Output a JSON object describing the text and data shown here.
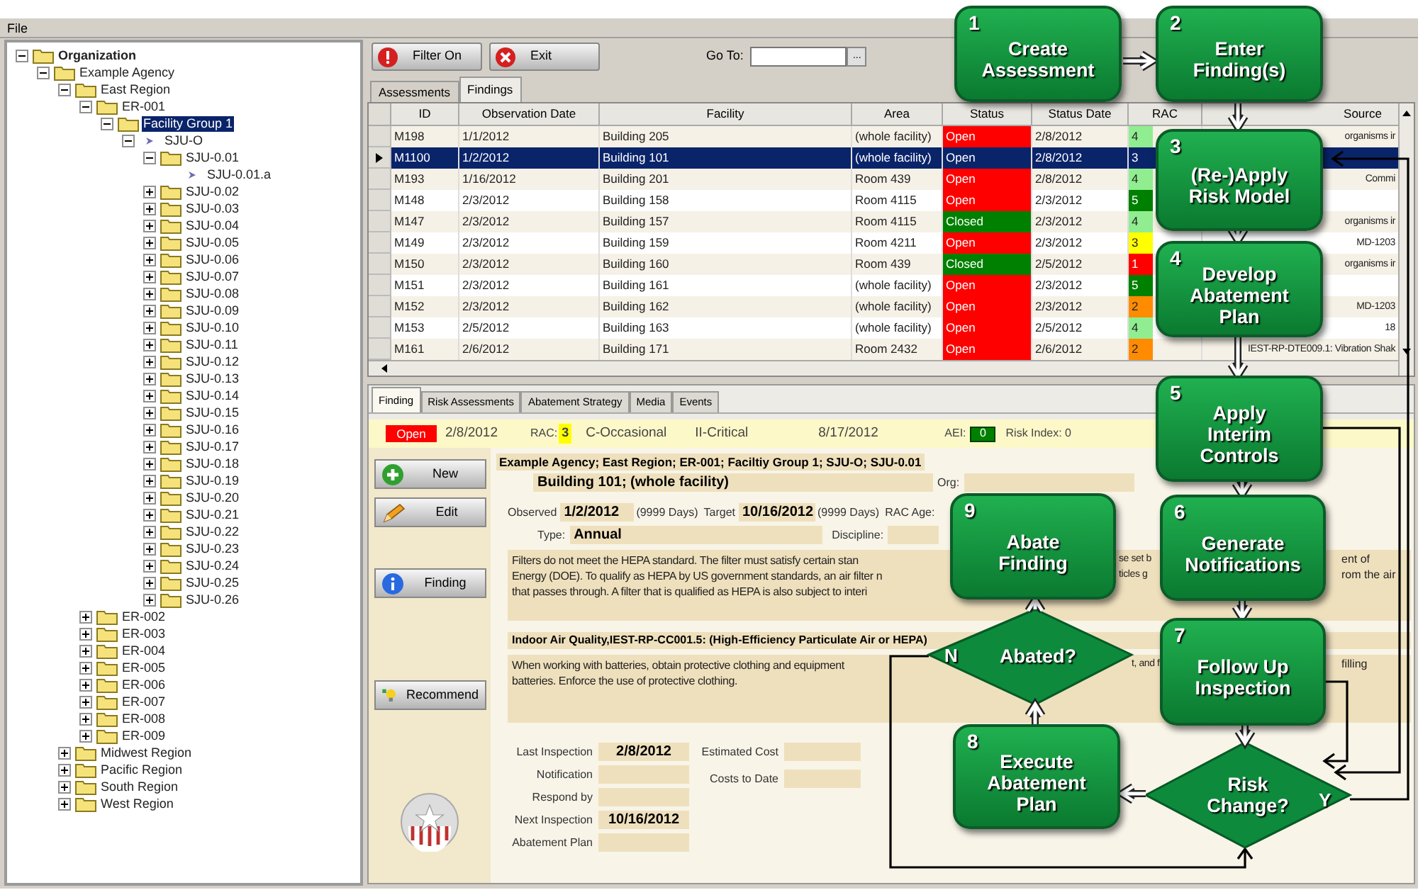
{
  "menu": [
    "File"
  ],
  "tree": {
    "label": "Organization",
    "kind": "folder",
    "expanded": true,
    "selected": false,
    "children": [
      {
        "label": "Example Agency",
        "kind": "folder",
        "expanded": true,
        "selected": false,
        "children": [
          {
            "label": "East Region",
            "kind": "folder",
            "expanded": true,
            "selected": false,
            "children": [
              {
                "label": "ER-001",
                "kind": "folder",
                "expanded": true,
                "selected": false,
                "children": [
                  {
                    "label": "Facility Group 1",
                    "kind": "folder",
                    "expanded": true,
                    "selected": true,
                    "children": [
                      {
                        "label": "SJU-O",
                        "kind": "item",
                        "expanded": true,
                        "selected": false,
                        "children": [
                          {
                            "label": "SJU-0.01",
                            "kind": "folder",
                            "expanded": true,
                            "selected": false,
                            "children": [
                              {
                                "label": "SJU-0.01.a",
                                "kind": "item",
                                "selected": false
                              }
                            ]
                          },
                          {
                            "label": "SJU-0.02",
                            "kind": "folder",
                            "expanded": false,
                            "selected": false
                          },
                          {
                            "label": "SJU-0.03",
                            "kind": "folder",
                            "expanded": false,
                            "selected": false
                          },
                          {
                            "label": "SJU-0.04",
                            "kind": "folder",
                            "expanded": false,
                            "selected": false
                          },
                          {
                            "label": "SJU-0.05",
                            "kind": "folder",
                            "expanded": false,
                            "selected": false
                          },
                          {
                            "label": "SJU-0.06",
                            "kind": "folder",
                            "expanded": false,
                            "selected": false
                          },
                          {
                            "label": "SJU-0.07",
                            "kind": "folder",
                            "expanded": false,
                            "selected": false
                          },
                          {
                            "label": "SJU-0.08",
                            "kind": "folder",
                            "expanded": false,
                            "selected": false
                          },
                          {
                            "label": "SJU-0.09",
                            "kind": "folder",
                            "expanded": false,
                            "selected": false
                          },
                          {
                            "label": "SJU-0.10",
                            "kind": "folder",
                            "expanded": false,
                            "selected": false
                          },
                          {
                            "label": "SJU-0.11",
                            "kind": "folder",
                            "expanded": false,
                            "selected": false
                          },
                          {
                            "label": "SJU-0.12",
                            "kind": "folder",
                            "expanded": false,
                            "selected": false
                          },
                          {
                            "label": "SJU-0.13",
                            "kind": "folder",
                            "expanded": false,
                            "selected": false
                          },
                          {
                            "label": "SJU-0.14",
                            "kind": "folder",
                            "expanded": false,
                            "selected": false
                          },
                          {
                            "label": "SJU-0.15",
                            "kind": "folder",
                            "expanded": false,
                            "selected": false
                          },
                          {
                            "label": "SJU-0.16",
                            "kind": "folder",
                            "expanded": false,
                            "selected": false
                          },
                          {
                            "label": "SJU-0.17",
                            "kind": "folder",
                            "expanded": false,
                            "selected": false
                          },
                          {
                            "label": "SJU-0.18",
                            "kind": "folder",
                            "expanded": false,
                            "selected": false
                          },
                          {
                            "label": "SJU-0.19",
                            "kind": "folder",
                            "expanded": false,
                            "selected": false
                          },
                          {
                            "label": "SJU-0.20",
                            "kind": "folder",
                            "expanded": false,
                            "selected": false
                          },
                          {
                            "label": "SJU-0.21",
                            "kind": "folder",
                            "expanded": false,
                            "selected": false
                          },
                          {
                            "label": "SJU-0.22",
                            "kind": "folder",
                            "expanded": false,
                            "selected": false
                          },
                          {
                            "label": "SJU-0.23",
                            "kind": "folder",
                            "expanded": false,
                            "selected": false
                          },
                          {
                            "label": "SJU-0.24",
                            "kind": "folder",
                            "expanded": false,
                            "selected": false
                          },
                          {
                            "label": "SJU-0.25",
                            "kind": "folder",
                            "expanded": false,
                            "selected": false
                          },
                          {
                            "label": "SJU-0.26",
                            "kind": "folder",
                            "expanded": false,
                            "selected": false
                          }
                        ]
                      }
                    ]
                  }
                ]
              },
              {
                "label": "ER-002",
                "kind": "folder",
                "expanded": false,
                "selected": false
              },
              {
                "label": "ER-003",
                "kind": "folder",
                "expanded": false,
                "selected": false
              },
              {
                "label": "ER-004",
                "kind": "folder",
                "expanded": false,
                "selected": false
              },
              {
                "label": "ER-005",
                "kind": "folder",
                "expanded": false,
                "selected": false
              },
              {
                "label": "ER-006",
                "kind": "folder",
                "expanded": false,
                "selected": false
              },
              {
                "label": "ER-007",
                "kind": "folder",
                "expanded": false,
                "selected": false
              },
              {
                "label": "ER-008",
                "kind": "folder",
                "expanded": false,
                "selected": false
              },
              {
                "label": "ER-009",
                "kind": "folder",
                "expanded": false,
                "selected": false
              }
            ]
          },
          {
            "label": "Midwest Region",
            "kind": "folder",
            "expanded": false,
            "selected": false
          },
          {
            "label": "Pacific Region",
            "kind": "folder",
            "expanded": false,
            "selected": false
          },
          {
            "label": "South Region",
            "kind": "folder",
            "expanded": false,
            "selected": false
          },
          {
            "label": "West Region",
            "kind": "folder",
            "expanded": false,
            "selected": false
          }
        ]
      }
    ]
  },
  "toolbar": {
    "buttons": [
      {
        "kind": "filter",
        "label": "Filter On"
      },
      {
        "kind": "exit",
        "label": "Exit"
      }
    ],
    "goto_label": "Go To:",
    "browse": "..."
  },
  "top_tabs": [
    {
      "label": "Assessments",
      "selected": false
    },
    {
      "label": "Findings",
      "selected": true
    }
  ],
  "table": {
    "columns": [
      "ID",
      "Observation Date",
      "Facility",
      "Area",
      "Status",
      "Status Date",
      "RAC",
      "Source"
    ],
    "rows": [
      {
        "id": "M198",
        "observed": "1/1/2012",
        "facility": "Building 205",
        "area": "(whole facility)",
        "status": {
          "text": "Open",
          "color": "#ff0000"
        },
        "status_date": "2/8/2012",
        "rac": {
          "text": "4",
          "color": "#90ee90"
        },
        "source": "organisms ir",
        "selected": false
      },
      {
        "id": "M1100",
        "observed": "1/2/2012",
        "facility": "Building 101",
        "area": "(whole facility)",
        "status": {
          "text": "Open"
        },
        "status_date": "2/8/2012",
        "rac": {
          "text": "3"
        },
        "selected": true
      },
      {
        "id": "M193",
        "observed": "1/16/2012",
        "facility": "Building 201",
        "area": "Room 439",
        "status": {
          "text": "Open",
          "color": "#ff0000"
        },
        "status_date": "2/8/2012",
        "rac": {
          "text": "4",
          "color": "#90ee90"
        },
        "source": "Commi",
        "selected": false
      },
      {
        "id": "M148",
        "observed": "2/3/2012",
        "facility": "Building 158",
        "area": "Room 4115",
        "status": {
          "text": "Open",
          "color": "#ff0000"
        },
        "status_date": "2/3/2012",
        "rac": {
          "text": "5",
          "color": "#008000"
        },
        "selected": false
      },
      {
        "id": "M147",
        "observed": "2/3/2012",
        "facility": "Building 157",
        "area": "Room 4115",
        "status": {
          "text": "Closed",
          "color": "#008000"
        },
        "status_date": "2/3/2012",
        "rac": {
          "text": "4",
          "color": "#90ee90"
        },
        "source": "organisms ir",
        "selected": false
      },
      {
        "id": "M149",
        "observed": "2/3/2012",
        "facility": "Building 159",
        "area": "Room 4211",
        "status": {
          "text": "Open",
          "color": "#ff0000"
        },
        "status_date": "2/3/2012",
        "rac": {
          "text": "3",
          "color": "#ffff00"
        },
        "source": "MD-1203",
        "selected": false
      },
      {
        "id": "M150",
        "observed": "2/3/2012",
        "facility": "Building 160",
        "area": "Room 439",
        "status": {
          "text": "Closed",
          "color": "#008000"
        },
        "status_date": "2/5/2012",
        "rac": {
          "text": "1",
          "color": "#ff0000"
        },
        "source": "organisms ir",
        "selected": false
      },
      {
        "id": "M151",
        "observed": "2/3/2012",
        "facility": "Building 161",
        "area": "(whole facility)",
        "status": {
          "text": "Open",
          "color": "#ff0000"
        },
        "status_date": "2/3/2012",
        "rac": {
          "text": "5",
          "color": "#008000"
        },
        "selected": false
      },
      {
        "id": "M152",
        "observed": "2/3/2012",
        "facility": "Building 162",
        "area": "(whole facility)",
        "status": {
          "text": "Open",
          "color": "#ff0000"
        },
        "status_date": "2/3/2012",
        "rac": {
          "text": "2",
          "color": "#ff8c00"
        },
        "source": "MD-1203",
        "selected": false
      },
      {
        "id": "M153",
        "observed": "2/5/2012",
        "facility": "Building 163",
        "area": "(whole facility)",
        "status": {
          "text": "Open",
          "color": "#ff0000"
        },
        "status_date": "2/5/2012",
        "rac": {
          "text": "4",
          "color": "#90ee90"
        },
        "source": "18",
        "selected": false
      },
      {
        "id": "M161",
        "observed": "2/6/2012",
        "facility": "Building 171",
        "area": "Room 2432",
        "status": {
          "text": "Open",
          "color": "#ff0000"
        },
        "status_date": "2/6/2012",
        "rac": {
          "text": "2",
          "color": "#ff8c00"
        },
        "source": "IEST-RP-DTE009.1: Vibration Shak",
        "selected": false
      }
    ]
  },
  "detail_tabs": [
    {
      "label": "Finding",
      "selected": true
    },
    {
      "label": "Risk Assessments",
      "selected": false
    },
    {
      "label": "Abatement Strategy",
      "selected": false
    },
    {
      "label": "Media",
      "selected": false
    },
    {
      "label": "Events",
      "selected": false
    }
  ],
  "summary": {
    "status": "Open",
    "status_date": "2/8/2012",
    "rac_label": "RAC:",
    "rac": "3",
    "probability": "C-Occasional",
    "severity": "II-Critical",
    "date": "8/17/2012",
    "aei_label": "AEI:",
    "aei": "0",
    "risk_index": "Risk Index: 0"
  },
  "side_buttons": [
    {
      "kind": "new",
      "label": "New"
    },
    {
      "kind": "edit",
      "label": "Edit"
    },
    {
      "kind": "finding",
      "label": "Finding"
    },
    {
      "kind": "recommend",
      "label": "Recommend"
    }
  ],
  "form": {
    "breadcrumb": "Example Agency; East Region; ER-001; Faciltiy Group 1; SJU-O; SJU-0.01",
    "location": "Building 101; (whole facility)",
    "org_label": "Org:",
    "observed_label": "Observed",
    "observed": "1/2/2012",
    "observed_days": "(9999 Days)",
    "target_label": "Target",
    "target": "10/16/2012",
    "target_days": "(9999 Days)",
    "rac_age_label": "RAC Age:",
    "type_label": "Type:",
    "type": "Annual",
    "discipline_label": "Discipline:",
    "description": [
      {
        "left": "Filters do not meet the HEPA standard.  The filter must satisfy certain stan",
        "middle": "se set b",
        "right": "ent of"
      },
      {
        "left": "Energy (DOE). To qualify as HEPA by US government standards, an air filter n",
        "middle": "ticles g",
        "right": "rom the air"
      },
      {
        "left": "that passes through. A filter that is qualified as HEPA is also subject to interi"
      }
    ],
    "standard": "Indoor Air Quality,IEST-RP-CC001.5:  (High-Efficiency Particulate Air or HEPA)",
    "recommendation": [
      {
        "left": "When working with batteries, obtain protective clothing and equipment",
        "middle": "t, and f",
        "right": "filling"
      },
      {
        "left": "batteries.  Enforce the use of protective clothing."
      }
    ],
    "dates": [
      {
        "label": "Last Inspection",
        "value": "2/8/2012"
      },
      {
        "label": "Notification"
      },
      {
        "label": "Respond by"
      },
      {
        "label": "Next Inspection",
        "value": "10/16/2012"
      },
      {
        "label": "Abatement Plan"
      }
    ],
    "costs": [
      {
        "label": "Estimated Cost"
      },
      {
        "label": "Costs to Date"
      }
    ]
  },
  "flowchart": {
    "steps": [
      {
        "number": "1",
        "label": [
          "Create",
          "Assessment"
        ]
      },
      {
        "number": "2",
        "label": [
          "Enter",
          "Finding(s)"
        ]
      },
      {
        "number": "3",
        "label": [
          "(Re-)Apply",
          "Risk Model"
        ]
      },
      {
        "number": "4",
        "label": [
          "Develop",
          "Abatement",
          "Plan"
        ]
      },
      {
        "number": "5",
        "label": [
          "Apply",
          "Interim",
          "Controls"
        ]
      },
      {
        "number": "9",
        "label": [
          "Abate",
          "Finding"
        ]
      },
      {
        "number": "6",
        "label": [
          "Generate",
          "Notifications"
        ]
      },
      {
        "number": "7",
        "label": [
          "Follow Up",
          "Inspection"
        ]
      },
      {
        "number": "8",
        "label": [
          "Execute",
          "Abatement",
          "Plan"
        ]
      }
    ],
    "decisions": [
      {
        "label": [
          "Abated?"
        ],
        "branch": "N"
      },
      {
        "label": [
          "Risk",
          "Change?"
        ],
        "branch": "Y"
      }
    ]
  }
}
